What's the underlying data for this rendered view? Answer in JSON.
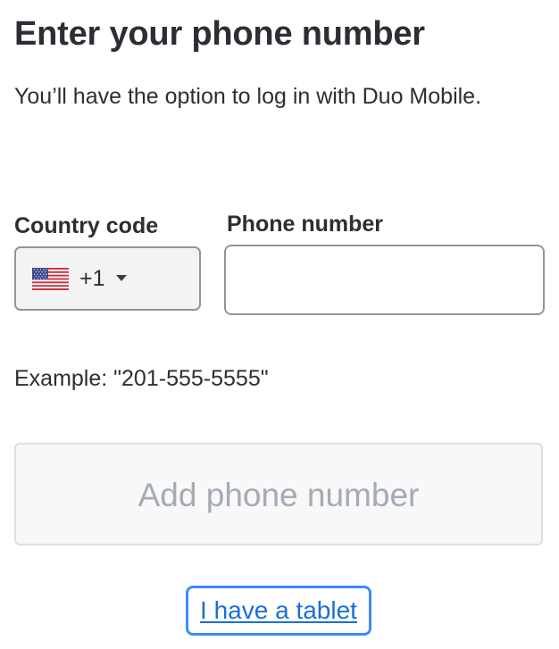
{
  "header": {
    "title": "Enter your phone number",
    "subtitle": "You’ll have the option to log in with Duo Mobile."
  },
  "form": {
    "country_code": {
      "label": "Country code",
      "selected_value": "+1",
      "flag_icon": "us-flag-icon"
    },
    "phone_number": {
      "label": "Phone number",
      "value": "",
      "placeholder": ""
    },
    "example_text": "Example: \"201-555-5555\""
  },
  "actions": {
    "add_button_label": "Add phone number",
    "add_button_disabled": true,
    "tablet_link_label": "I have a tablet"
  },
  "colors": {
    "text": "#2b2f33",
    "input_border": "#8f969c",
    "select_bg": "#f3f3f4",
    "disabled_text": "#a3abb4",
    "disabled_border": "#dcdfe3",
    "link": "#1a6fd8",
    "focus_ring": "#3c8df0"
  }
}
